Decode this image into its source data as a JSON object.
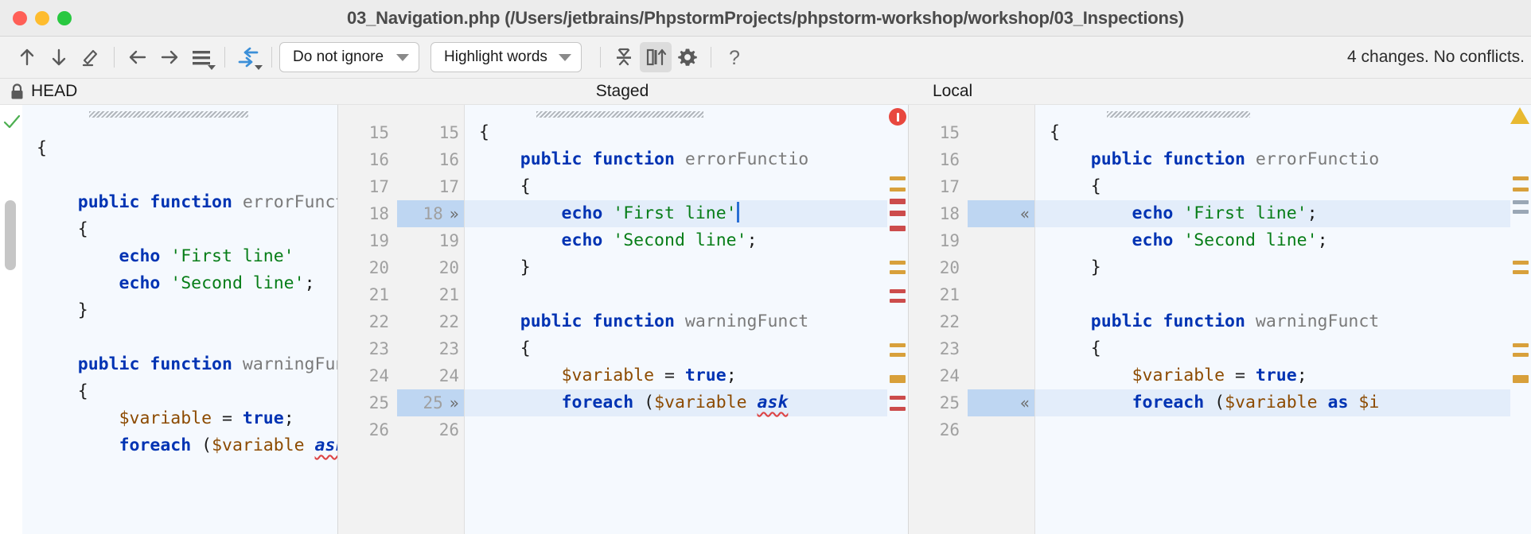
{
  "window": {
    "title": "03_Navigation.php (/Users/jetbrains/PhpstormProjects/phpstorm-workshop/workshop/03_Inspections)",
    "controls": {
      "close": "close",
      "minimize": "minimize",
      "maximize": "maximize"
    }
  },
  "toolbar": {
    "prev_difference": "Previous Difference",
    "next_difference": "Next Difference",
    "edit": "Edit",
    "apply_left": "Accept Left",
    "apply_right": "Accept Right",
    "lines_menu": "Lines Options",
    "resolve": "Apply Non-Conflicting Changes",
    "ignore_label": "Do not ignore",
    "highlight_label": "Highlight words",
    "collapse_unchanged": "Collapse Unchanged Fragments",
    "sync_scroll": "Synchronize Scrolling",
    "settings": "Settings",
    "help": "?",
    "status": "4 changes. No conflicts."
  },
  "panes": {
    "left": {
      "title": "HEAD",
      "locked": true,
      "icon": "lock-icon"
    },
    "mid": {
      "title": "Staged",
      "locked": false,
      "icon": ""
    },
    "right": {
      "title": "Local",
      "locked": false,
      "icon": ""
    }
  },
  "left_code": [
    {
      "n": "",
      "tokens": []
    },
    {
      "n": "",
      "tokens": [
        {
          "t": "{",
          "c": ""
        }
      ]
    },
    {
      "n": "",
      "tokens": []
    },
    {
      "n": "",
      "tokens": [
        {
          "t": "    ",
          "c": ""
        },
        {
          "t": "public function ",
          "c": "kw"
        },
        {
          "t": "errorFunct",
          "c": "fn"
        }
      ]
    },
    {
      "n": "",
      "tokens": [
        {
          "t": "    {",
          "c": ""
        }
      ]
    },
    {
      "n": "",
      "tokens": [
        {
          "t": "        echo ",
          "c": "kw"
        },
        {
          "t": "'First line'",
          "c": "str"
        }
      ]
    },
    {
      "n": "",
      "tokens": [
        {
          "t": "        echo ",
          "c": "kw"
        },
        {
          "t": "'Second line'",
          "c": "str"
        },
        {
          "t": ";",
          "c": ""
        }
      ]
    },
    {
      "n": "",
      "tokens": [
        {
          "t": "    }",
          "c": ""
        }
      ]
    },
    {
      "n": "",
      "tokens": []
    },
    {
      "n": "",
      "tokens": [
        {
          "t": "    ",
          "c": ""
        },
        {
          "t": "public function ",
          "c": "kw"
        },
        {
          "t": "warningFun",
          "c": "fn"
        }
      ]
    },
    {
      "n": "",
      "tokens": [
        {
          "t": "    {",
          "c": ""
        }
      ]
    },
    {
      "n": "",
      "tokens": [
        {
          "t": "        ",
          "c": ""
        },
        {
          "t": "$variable",
          "c": "var"
        },
        {
          "t": " = ",
          "c": ""
        },
        {
          "t": "true",
          "c": "bool"
        },
        {
          "t": ";",
          "c": ""
        }
      ]
    },
    {
      "n": "",
      "tokens": [
        {
          "t": "        ",
          "c": ""
        },
        {
          "t": "foreach ",
          "c": "kw"
        },
        {
          "t": "(",
          "c": ""
        },
        {
          "t": "$variable",
          "c": "var"
        },
        {
          "t": " ",
          "c": ""
        },
        {
          "t": "ask",
          "c": "asq"
        }
      ]
    }
  ],
  "mid_code": {
    "rows": [
      {
        "a": "15",
        "b": "15",
        "marker": "",
        "hl": false,
        "tokens": [
          {
            "t": "{",
            "c": ""
          }
        ]
      },
      {
        "a": "16",
        "b": "16",
        "marker": "",
        "hl": false,
        "tokens": [
          {
            "t": "    ",
            "c": ""
          },
          {
            "t": "public function ",
            "c": "kw"
          },
          {
            "t": "errorFunctio",
            "c": "fn"
          }
        ]
      },
      {
        "a": "17",
        "b": "17",
        "marker": "",
        "hl": false,
        "tokens": [
          {
            "t": "    {",
            "c": ""
          }
        ]
      },
      {
        "a": "18",
        "b": "18",
        "marker": "»",
        "hl": true,
        "tokens": [
          {
            "t": "        echo ",
            "c": "kw"
          },
          {
            "t": "'First line'",
            "c": "str"
          }
        ]
      },
      {
        "a": "19",
        "b": "19",
        "marker": "",
        "hl": false,
        "tokens": [
          {
            "t": "        echo ",
            "c": "kw"
          },
          {
            "t": "'Second line'",
            "c": "str"
          },
          {
            "t": ";",
            "c": ""
          }
        ]
      },
      {
        "a": "20",
        "b": "20",
        "marker": "",
        "hl": false,
        "tokens": [
          {
            "t": "    }",
            "c": ""
          }
        ]
      },
      {
        "a": "21",
        "b": "21",
        "marker": "",
        "hl": false,
        "tokens": []
      },
      {
        "a": "22",
        "b": "22",
        "marker": "",
        "hl": false,
        "tokens": [
          {
            "t": "    ",
            "c": ""
          },
          {
            "t": "public function ",
            "c": "kw"
          },
          {
            "t": "warningFunct",
            "c": "fn"
          }
        ]
      },
      {
        "a": "23",
        "b": "23",
        "marker": "",
        "hl": false,
        "tokens": [
          {
            "t": "    {",
            "c": ""
          }
        ]
      },
      {
        "a": "24",
        "b": "24",
        "marker": "",
        "hl": false,
        "tokens": [
          {
            "t": "        ",
            "c": ""
          },
          {
            "t": "$variable",
            "c": "var"
          },
          {
            "t": " = ",
            "c": ""
          },
          {
            "t": "true",
            "c": "bool"
          },
          {
            "t": ";",
            "c": ""
          }
        ]
      },
      {
        "a": "25",
        "b": "25",
        "marker": "»",
        "hl": true,
        "tokens": [
          {
            "t": "        ",
            "c": ""
          },
          {
            "t": "foreach ",
            "c": "kw"
          },
          {
            "t": "(",
            "c": ""
          },
          {
            "t": "$variable",
            "c": "var"
          },
          {
            "t": " ",
            "c": ""
          },
          {
            "t": "ask",
            "c": "asq"
          }
        ]
      },
      {
        "a": "26",
        "b": "26",
        "marker": "",
        "hl": false,
        "tokens": []
      }
    ],
    "badge": "error"
  },
  "right_code": {
    "rows": [
      {
        "a": "15",
        "marker": "",
        "hl": false,
        "tokens": [
          {
            "t": "{",
            "c": ""
          }
        ]
      },
      {
        "a": "16",
        "marker": "",
        "hl": false,
        "tokens": [
          {
            "t": "    ",
            "c": ""
          },
          {
            "t": "public function ",
            "c": "kw"
          },
          {
            "t": "errorFunctio",
            "c": "fn"
          }
        ]
      },
      {
        "a": "17",
        "marker": "",
        "hl": false,
        "tokens": [
          {
            "t": "    {",
            "c": ""
          }
        ]
      },
      {
        "a": "18",
        "marker": "«",
        "hl": true,
        "tokens": [
          {
            "t": "        echo ",
            "c": "kw"
          },
          {
            "t": "'First line'",
            "c": "str"
          },
          {
            "t": ";",
            "c": ""
          }
        ]
      },
      {
        "a": "19",
        "marker": "",
        "hl": false,
        "tokens": [
          {
            "t": "        echo ",
            "c": "kw"
          },
          {
            "t": "'Second line'",
            "c": "str"
          },
          {
            "t": ";",
            "c": ""
          }
        ]
      },
      {
        "a": "20",
        "marker": "",
        "hl": false,
        "tokens": [
          {
            "t": "    }",
            "c": ""
          }
        ]
      },
      {
        "a": "21",
        "marker": "",
        "hl": false,
        "tokens": []
      },
      {
        "a": "22",
        "marker": "",
        "hl": false,
        "tokens": [
          {
            "t": "    ",
            "c": ""
          },
          {
            "t": "public function ",
            "c": "kw"
          },
          {
            "t": "warningFunct",
            "c": "fn"
          }
        ]
      },
      {
        "a": "23",
        "marker": "",
        "hl": false,
        "tokens": [
          {
            "t": "    {",
            "c": ""
          }
        ]
      },
      {
        "a": "24",
        "marker": "",
        "hl": false,
        "tokens": [
          {
            "t": "        ",
            "c": ""
          },
          {
            "t": "$variable",
            "c": "var"
          },
          {
            "t": " = ",
            "c": ""
          },
          {
            "t": "true",
            "c": "bool"
          },
          {
            "t": ";",
            "c": ""
          }
        ]
      },
      {
        "a": "25",
        "marker": "«",
        "hl": true,
        "tokens": [
          {
            "t": "        ",
            "c": ""
          },
          {
            "t": "foreach ",
            "c": "kw"
          },
          {
            "t": "(",
            "c": ""
          },
          {
            "t": "$variable",
            "c": "var"
          },
          {
            "t": " ",
            "c": ""
          },
          {
            "t": "as",
            "c": "kw"
          },
          {
            "t": " ",
            "c": ""
          },
          {
            "t": "$i",
            "c": "var"
          }
        ]
      },
      {
        "a": "26",
        "marker": "",
        "hl": false,
        "tokens": []
      }
    ],
    "badge": "warning"
  },
  "colors": {
    "accent_blue": "#3b80d8",
    "keyword": "#0033b3",
    "string": "#067d17",
    "variable": "#8c4a00",
    "changed_bg": "#e3edfa",
    "gutter_hl": "#bed6f2",
    "error": "#e8483f",
    "warning": "#e8b931",
    "modified_marker": "#d8a03b",
    "deleted_marker": "#cc4c4c"
  }
}
